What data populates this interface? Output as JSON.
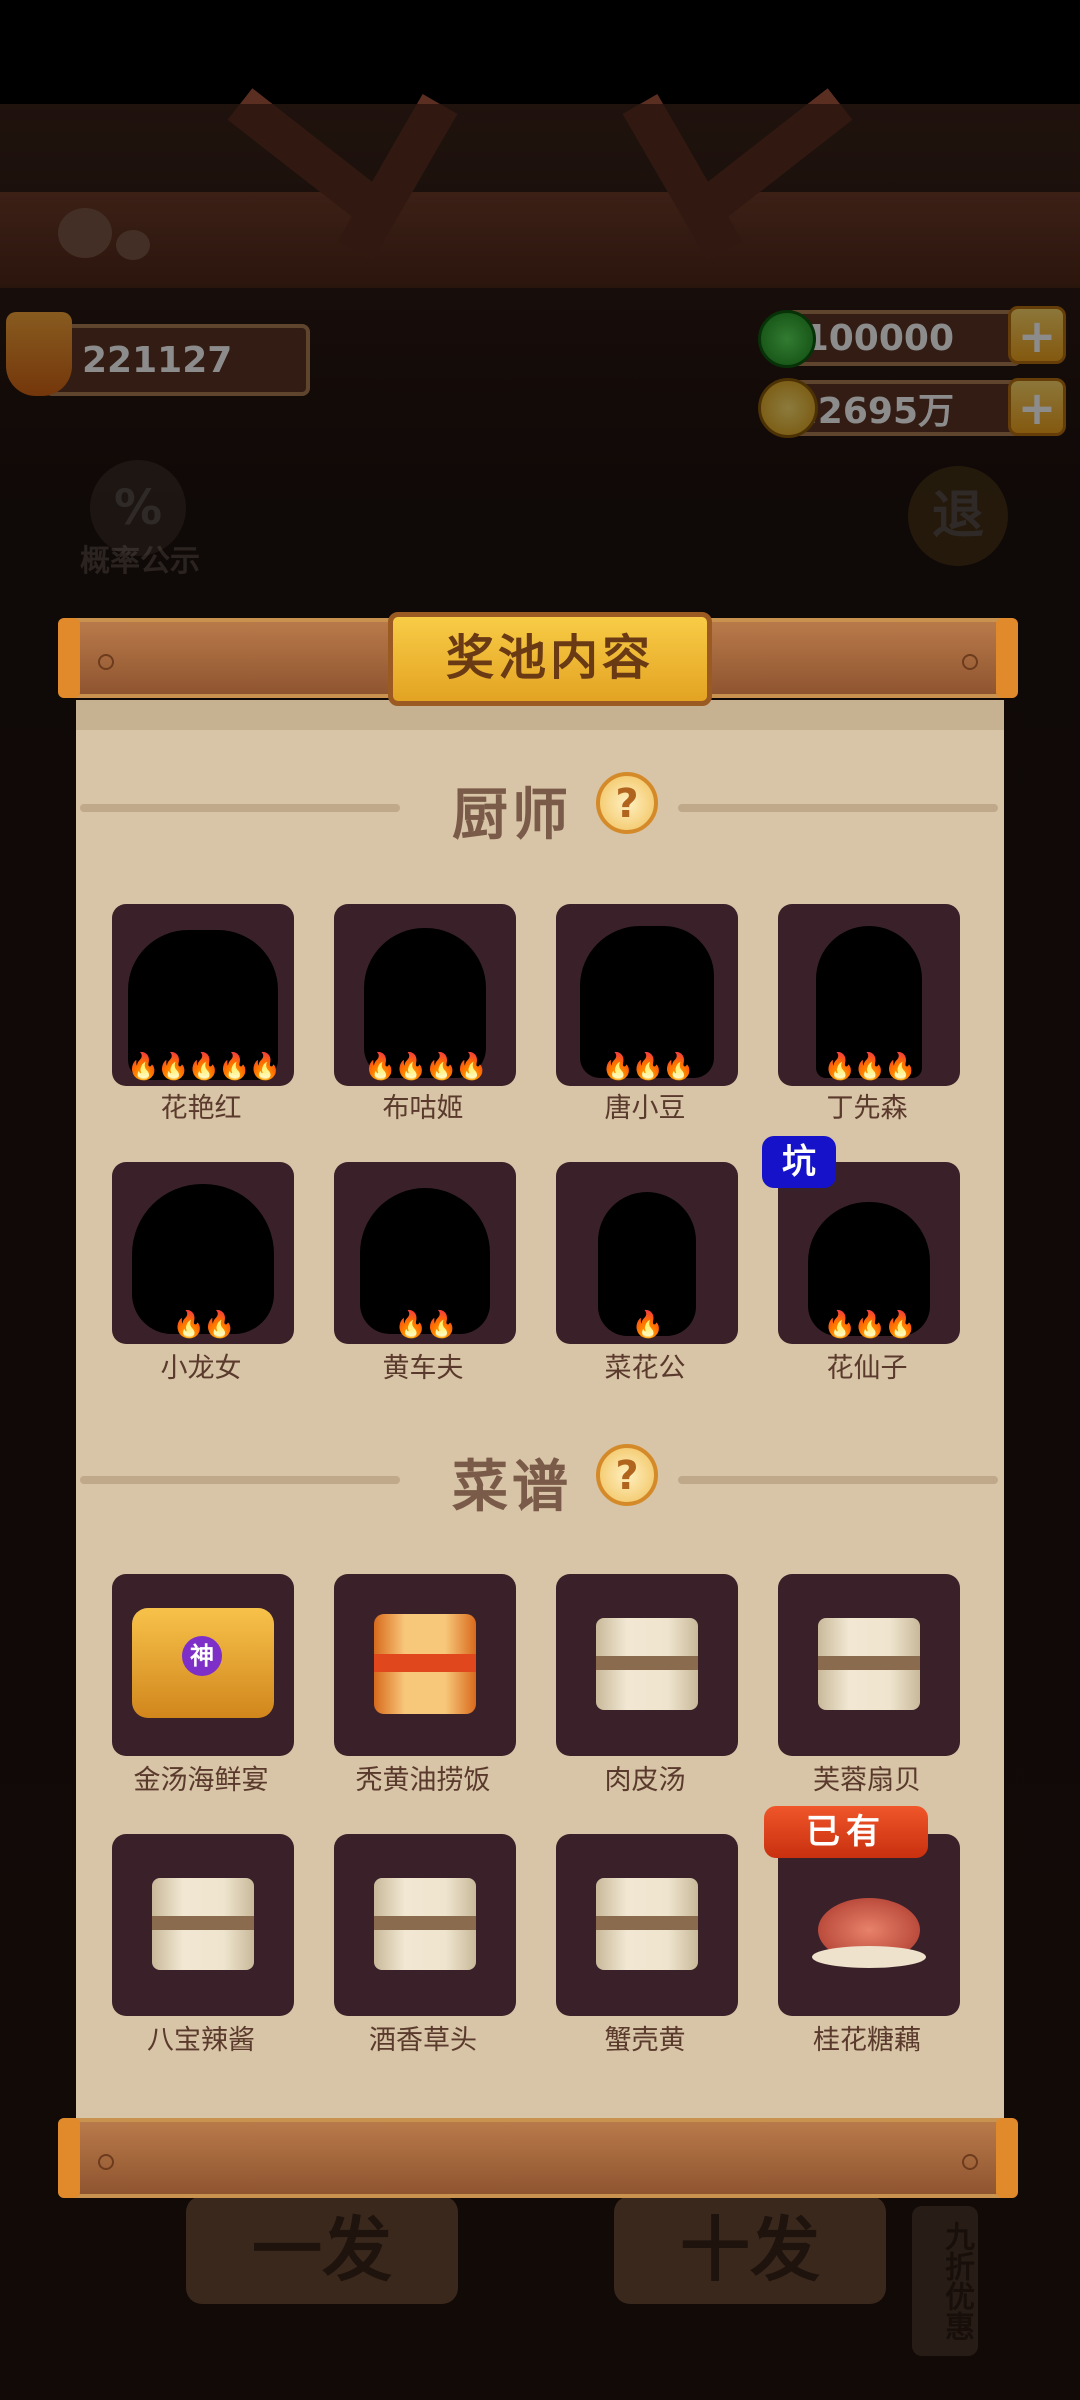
{
  "header": {
    "score": "221127",
    "currency_green": "100000",
    "currency_coin": "22695万",
    "prob_label": "概率公示",
    "prob_icon_text": "%",
    "exit_label": "退"
  },
  "panel": {
    "title": "奖池内容",
    "chef_section": {
      "title": "厨师",
      "help": "?",
      "items": [
        {
          "name": "花艳红",
          "flames": "🔥🔥🔥🔥🔥"
        },
        {
          "name": "布咕姬",
          "flames": "🔥🔥🔥🔥"
        },
        {
          "name": "唐小豆",
          "flames": "🔥🔥🔥"
        },
        {
          "name": "丁先森",
          "flames": "🔥🔥🔥"
        },
        {
          "name": "小龙女",
          "flames": "🔥🔥"
        },
        {
          "name": "黄车夫",
          "flames": "🔥🔥"
        },
        {
          "name": "菜花公",
          "flames": "🔥"
        },
        {
          "name": "花仙子",
          "flames": "🔥🔥🔥",
          "badge": "坑"
        }
      ]
    },
    "recipe_section": {
      "title": "菜谱",
      "help": "?",
      "items": [
        {
          "name": "金汤海鲜宴",
          "badge_inner": "神"
        },
        {
          "name": "秃黄油捞饭"
        },
        {
          "name": "肉皮汤"
        },
        {
          "name": "芙蓉扇贝"
        },
        {
          "name": "八宝辣酱"
        },
        {
          "name": "酒香草头"
        },
        {
          "name": "蟹壳黄"
        },
        {
          "name": "桂花糖藕",
          "badge": "已有"
        }
      ]
    }
  },
  "bottom": {
    "single_draw": "一发",
    "ten_draw": "十发",
    "discount": "九折优惠"
  }
}
